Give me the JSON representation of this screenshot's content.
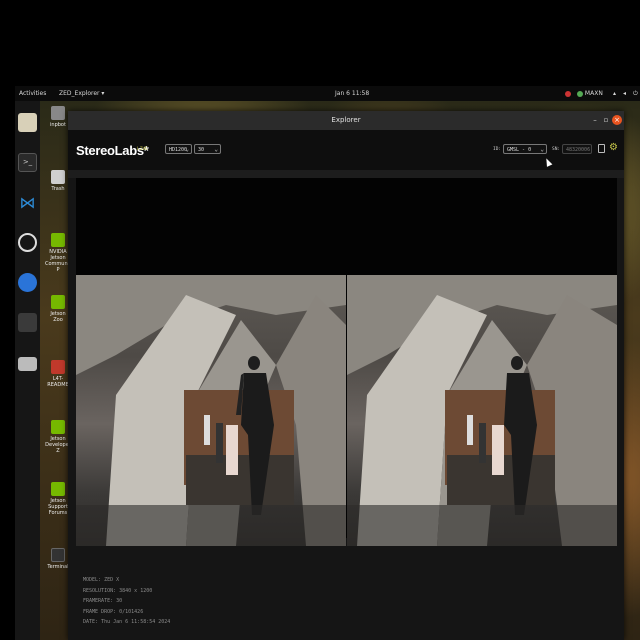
{
  "topbar": {
    "activities": "Activities",
    "app_menu": "ZED_Explorer ▾",
    "clock": "Jan 6  11:58",
    "power_mode": "MAXN"
  },
  "desktop_icons": [
    {
      "label": "inpbot"
    },
    {
      "label": "Trash"
    },
    {
      "label": "NVIDIA Jetson Community P"
    },
    {
      "label": "Jetson Zoo"
    },
    {
      "label": "L4T-README"
    },
    {
      "label": "Jetson Developer Z"
    },
    {
      "label": "Jetson Support Forums"
    },
    {
      "label": "Terminal"
    }
  ],
  "window": {
    "title": "Explorer",
    "header": {
      "logo": "StereoLabs*",
      "live": "LIVE",
      "resolution_select": "HD1200",
      "fps_select": "30",
      "id_label": "ID:",
      "id_select": "GMSL - 0",
      "sn_label": "SN:",
      "sn_value": "48320006"
    },
    "info": {
      "model": "MODEL: ZED X",
      "resolution": "RESOLUTION: 3840 x 1200",
      "framerate": "FRAMERATE: 30",
      "frame_drop": "FRAME DROP: 0/101426",
      "date": "DATE: Thu Jan 6 11:58:54 2024"
    }
  },
  "colors": {
    "accent_live": "#c8c84a",
    "window_bg": "#151515",
    "topbar_bg": "#0b0b0b"
  }
}
